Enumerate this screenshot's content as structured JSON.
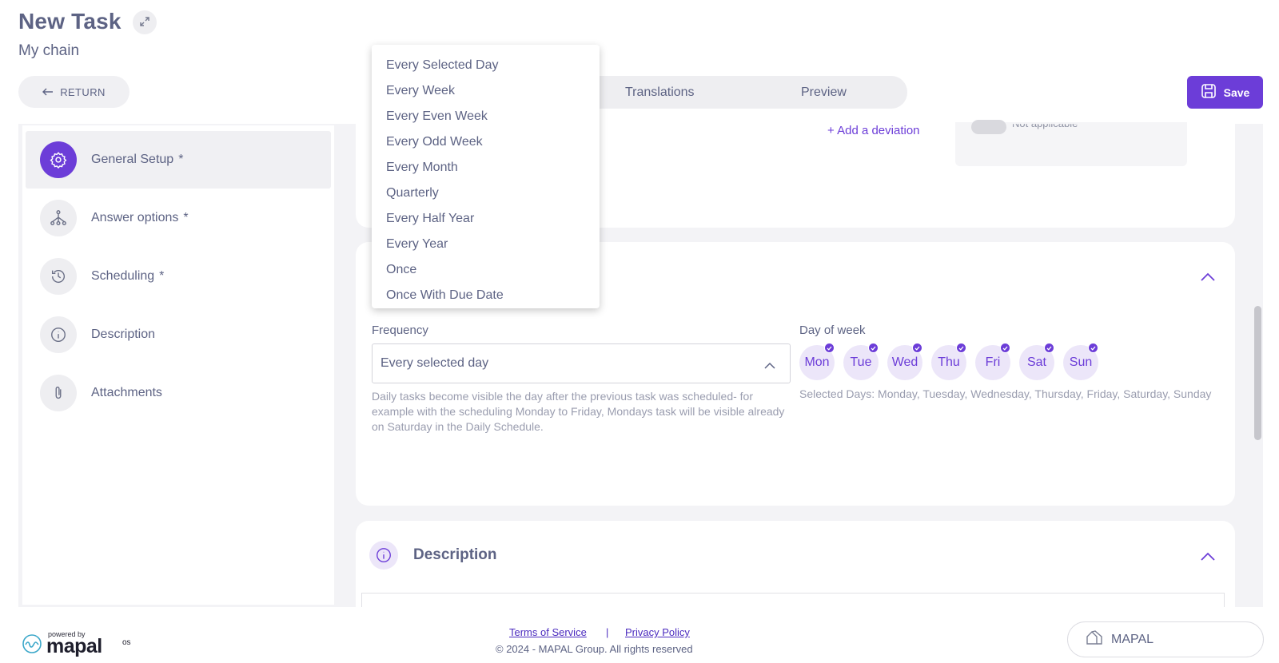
{
  "header": {
    "title": "New Task",
    "subtitle": "My chain",
    "return_label": "RETURN",
    "save_label": "Save",
    "tabs": [
      {
        "label": "Translations"
      },
      {
        "label": "Preview"
      }
    ]
  },
  "sidebar": {
    "items": [
      {
        "label": "General Setup",
        "required": "*",
        "icon": "gear-icon"
      },
      {
        "label": "Answer options",
        "required": "*",
        "icon": "hierarchy-icon"
      },
      {
        "label": "Scheduling",
        "required": "*",
        "icon": "history-icon"
      },
      {
        "label": "Description",
        "required": "",
        "icon": "info-icon"
      },
      {
        "label": "Attachments",
        "required": "",
        "icon": "paperclip-icon"
      }
    ]
  },
  "general": {
    "add_deviation": "+ Add a deviation",
    "not_applicable": "Not applicable"
  },
  "scheduling": {
    "frequency_label": "Frequency",
    "frequency_value": "Every selected day",
    "frequency_help": "Daily tasks become visible the day after the previous task was scheduled- for example with the scheduling Monday to Friday, Mondays task will be visible already on Saturday in the Daily Schedule.",
    "day_of_week_label": "Day of week",
    "days": [
      {
        "label": "Mon",
        "selected": true
      },
      {
        "label": "Tue",
        "selected": true
      },
      {
        "label": "Wed",
        "selected": true
      },
      {
        "label": "Thu",
        "selected": true
      },
      {
        "label": "Fri",
        "selected": true
      },
      {
        "label": "Sat",
        "selected": true
      },
      {
        "label": "Sun",
        "selected": true
      }
    ],
    "selected_days_text": "Selected Days: Monday, Tuesday, Wednesday, Thursday, Friday, Saturday, Sunday"
  },
  "description": {
    "title": "Description"
  },
  "frequency_dropdown": {
    "options": [
      "Every Selected Day",
      "Every Week",
      "Every Even Week",
      "Every Odd Week",
      "Every Month",
      "Quarterly",
      "Every Half Year",
      "Every Year",
      "Once",
      "Once With Due Date"
    ]
  },
  "footer": {
    "powered_by": "powered by",
    "brand": "mapal",
    "brand_suffix": "os",
    "terms": "Terms of Service",
    "separator": "|",
    "privacy": "Privacy Policy",
    "copyright": "© 2024 - MAPAL Group. All rights reserved",
    "org_name": "MAPAL"
  },
  "colors": {
    "accent": "#6c3dd8",
    "text": "#5d6384",
    "muted": "#9a9daf",
    "link": "#4b2bbf"
  }
}
